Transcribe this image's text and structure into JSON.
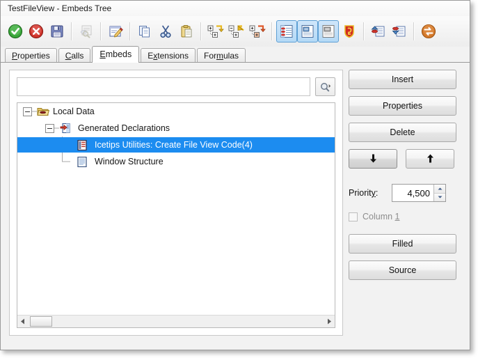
{
  "window": {
    "title": "TestFileView - Embeds Tree"
  },
  "toolbar": {
    "groups": [
      {
        "items": [
          {
            "name": "ok-check-icon",
            "label": "OK",
            "state": "enabled"
          },
          {
            "name": "cancel-icon",
            "label": "Cancel",
            "state": "enabled"
          },
          {
            "name": "save-disk-icon",
            "label": "Save",
            "state": "enabled"
          }
        ]
      },
      {
        "items": [
          {
            "name": "find-in-database-icon",
            "label": "Find",
            "state": "disabled"
          }
        ]
      },
      {
        "items": [
          {
            "name": "edit-pencil-icon",
            "label": "Edit",
            "state": "enabled"
          }
        ]
      },
      {
        "items": [
          {
            "name": "copy-icon",
            "label": "Copy",
            "state": "enabled"
          },
          {
            "name": "cut-scissors-icon",
            "label": "Cut",
            "state": "enabled"
          },
          {
            "name": "paste-clipboard-icon",
            "label": "Paste",
            "state": "enabled"
          }
        ]
      },
      {
        "items": [
          {
            "name": "expand-all-icon",
            "label": "Expand All",
            "state": "enabled"
          },
          {
            "name": "collapse-all-icon",
            "label": "Collapse All",
            "state": "enabled"
          },
          {
            "name": "expand-branch-icon",
            "label": "Expand Branch",
            "state": "enabled"
          }
        ]
      },
      {
        "items": [
          {
            "name": "view-list-icon",
            "label": "List View",
            "state": "pressed"
          },
          {
            "name": "view-detail-icon",
            "label": "Detail View",
            "state": "pressed"
          },
          {
            "name": "view-card-icon",
            "label": "Card View",
            "state": "pressed"
          },
          {
            "name": "shield-badge-icon",
            "label": "Template",
            "state": "enabled"
          }
        ]
      },
      {
        "items": [
          {
            "name": "move-up-list-icon",
            "label": "Move Up",
            "state": "enabled"
          },
          {
            "name": "move-down-list-icon",
            "label": "Move Down",
            "state": "enabled"
          }
        ]
      },
      {
        "items": [
          {
            "name": "refresh-sync-icon",
            "label": "Refresh",
            "state": "enabled"
          }
        ]
      }
    ]
  },
  "tabs": [
    {
      "label": "Properties",
      "accel": "P",
      "active": false
    },
    {
      "label": "Calls",
      "accel": "C",
      "active": false
    },
    {
      "label": "Embeds",
      "accel": "E",
      "active": true
    },
    {
      "label": "Extensions",
      "accel": "x",
      "active": false
    },
    {
      "label": "Formulas",
      "accel": "m",
      "active": false
    }
  ],
  "search": {
    "value": "",
    "placeholder": "",
    "button_icon": "search-magnifier-dropdown-icon"
  },
  "tree": {
    "nodes": [
      {
        "label": "Local Data",
        "depth": 0,
        "icon": "folder-open-icon",
        "expander": "minus",
        "selected": false
      },
      {
        "label": "Generated Declarations",
        "depth": 1,
        "icon": "declaration-arrow-icon",
        "expander": "minus",
        "selected": false
      },
      {
        "label": "Icetips Utilities: Create File View Code(4)",
        "depth": 2,
        "icon": "embed-code-icon",
        "expander": "none",
        "selected": true
      },
      {
        "label": "Window Structure",
        "depth": 2,
        "icon": "document-lines-icon",
        "expander": "none",
        "selected": false
      }
    ],
    "selection_color": "#1c8cf0"
  },
  "side_panel": {
    "insert_label": "Insert",
    "properties_label": "Properties",
    "delete_label": "Delete",
    "move_down_icon": "arrow-down-icon",
    "move_up_icon": "arrow-up-icon",
    "priority_label": "Priority:",
    "priority_accel": "y",
    "priority_value": "4,500",
    "column_label": "Column ",
    "column_accel": "1",
    "column_checked": false,
    "filled_label": "Filled",
    "source_label": "Source"
  },
  "scrollbar": {
    "left_arrow_icon": "scroll-left-arrow-icon",
    "right_arrow_icon": "scroll-right-arrow-icon"
  }
}
